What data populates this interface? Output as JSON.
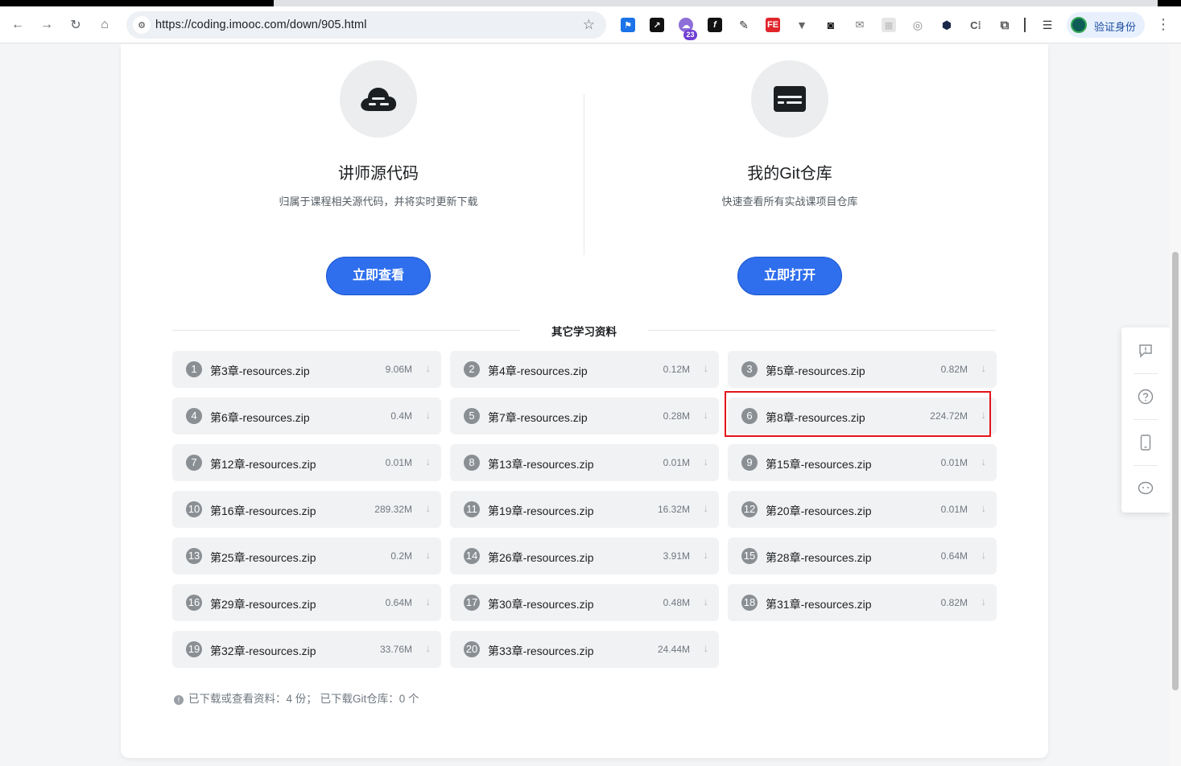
{
  "browser": {
    "url": "https://coding.imooc.com/down/905.html",
    "extension_badge": "23",
    "profile_label": "验证身份"
  },
  "features": [
    {
      "title": "讲师源代码",
      "desc": "归属于课程相关源代码，并将实时更新下载",
      "button": "立即查看",
      "icon": "cloud-icon"
    },
    {
      "title": "我的Git仓库",
      "desc": "快速查看所有实战课项目仓库",
      "button": "立即打开",
      "icon": "repo-icon"
    }
  ],
  "section_title": "其它学习资料",
  "files": [
    {
      "num": "1",
      "name": "第3章-resources.zip",
      "size": "9.06M"
    },
    {
      "num": "2",
      "name": "第4章-resources.zip",
      "size": "0.12M"
    },
    {
      "num": "3",
      "name": "第5章-resources.zip",
      "size": "0.82M"
    },
    {
      "num": "4",
      "name": "第6章-resources.zip",
      "size": "0.4M"
    },
    {
      "num": "5",
      "name": "第7章-resources.zip",
      "size": "0.28M"
    },
    {
      "num": "6",
      "name": "第8章-resources.zip",
      "size": "224.72M"
    },
    {
      "num": "7",
      "name": "第12章-resources.zip",
      "size": "0.01M"
    },
    {
      "num": "8",
      "name": "第13章-resources.zip",
      "size": "0.01M"
    },
    {
      "num": "9",
      "name": "第15章-resources.zip",
      "size": "0.01M"
    },
    {
      "num": "10",
      "name": "第16章-resources.zip",
      "size": "289.32M"
    },
    {
      "num": "11",
      "name": "第19章-resources.zip",
      "size": "16.32M"
    },
    {
      "num": "12",
      "name": "第20章-resources.zip",
      "size": "0.01M"
    },
    {
      "num": "13",
      "name": "第25章-resources.zip",
      "size": "0.2M"
    },
    {
      "num": "14",
      "name": "第26章-resources.zip",
      "size": "3.91M"
    },
    {
      "num": "15",
      "name": "第28章-resources.zip",
      "size": "0.64M"
    },
    {
      "num": "16",
      "name": "第29章-resources.zip",
      "size": "0.64M"
    },
    {
      "num": "17",
      "name": "第30章-resources.zip",
      "size": "0.48M"
    },
    {
      "num": "18",
      "name": "第31章-resources.zip",
      "size": "0.82M"
    },
    {
      "num": "19",
      "name": "第32章-resources.zip",
      "size": "33.76M"
    },
    {
      "num": "20",
      "name": "第33章-resources.zip",
      "size": "24.44M"
    }
  ],
  "download_icon_glyph": "↓",
  "stats_text": "已下载或查看资料：4 份； 已下载Git仓库：0 个",
  "highlight_color": "#e3141b",
  "accent_color": "#2f6fed"
}
